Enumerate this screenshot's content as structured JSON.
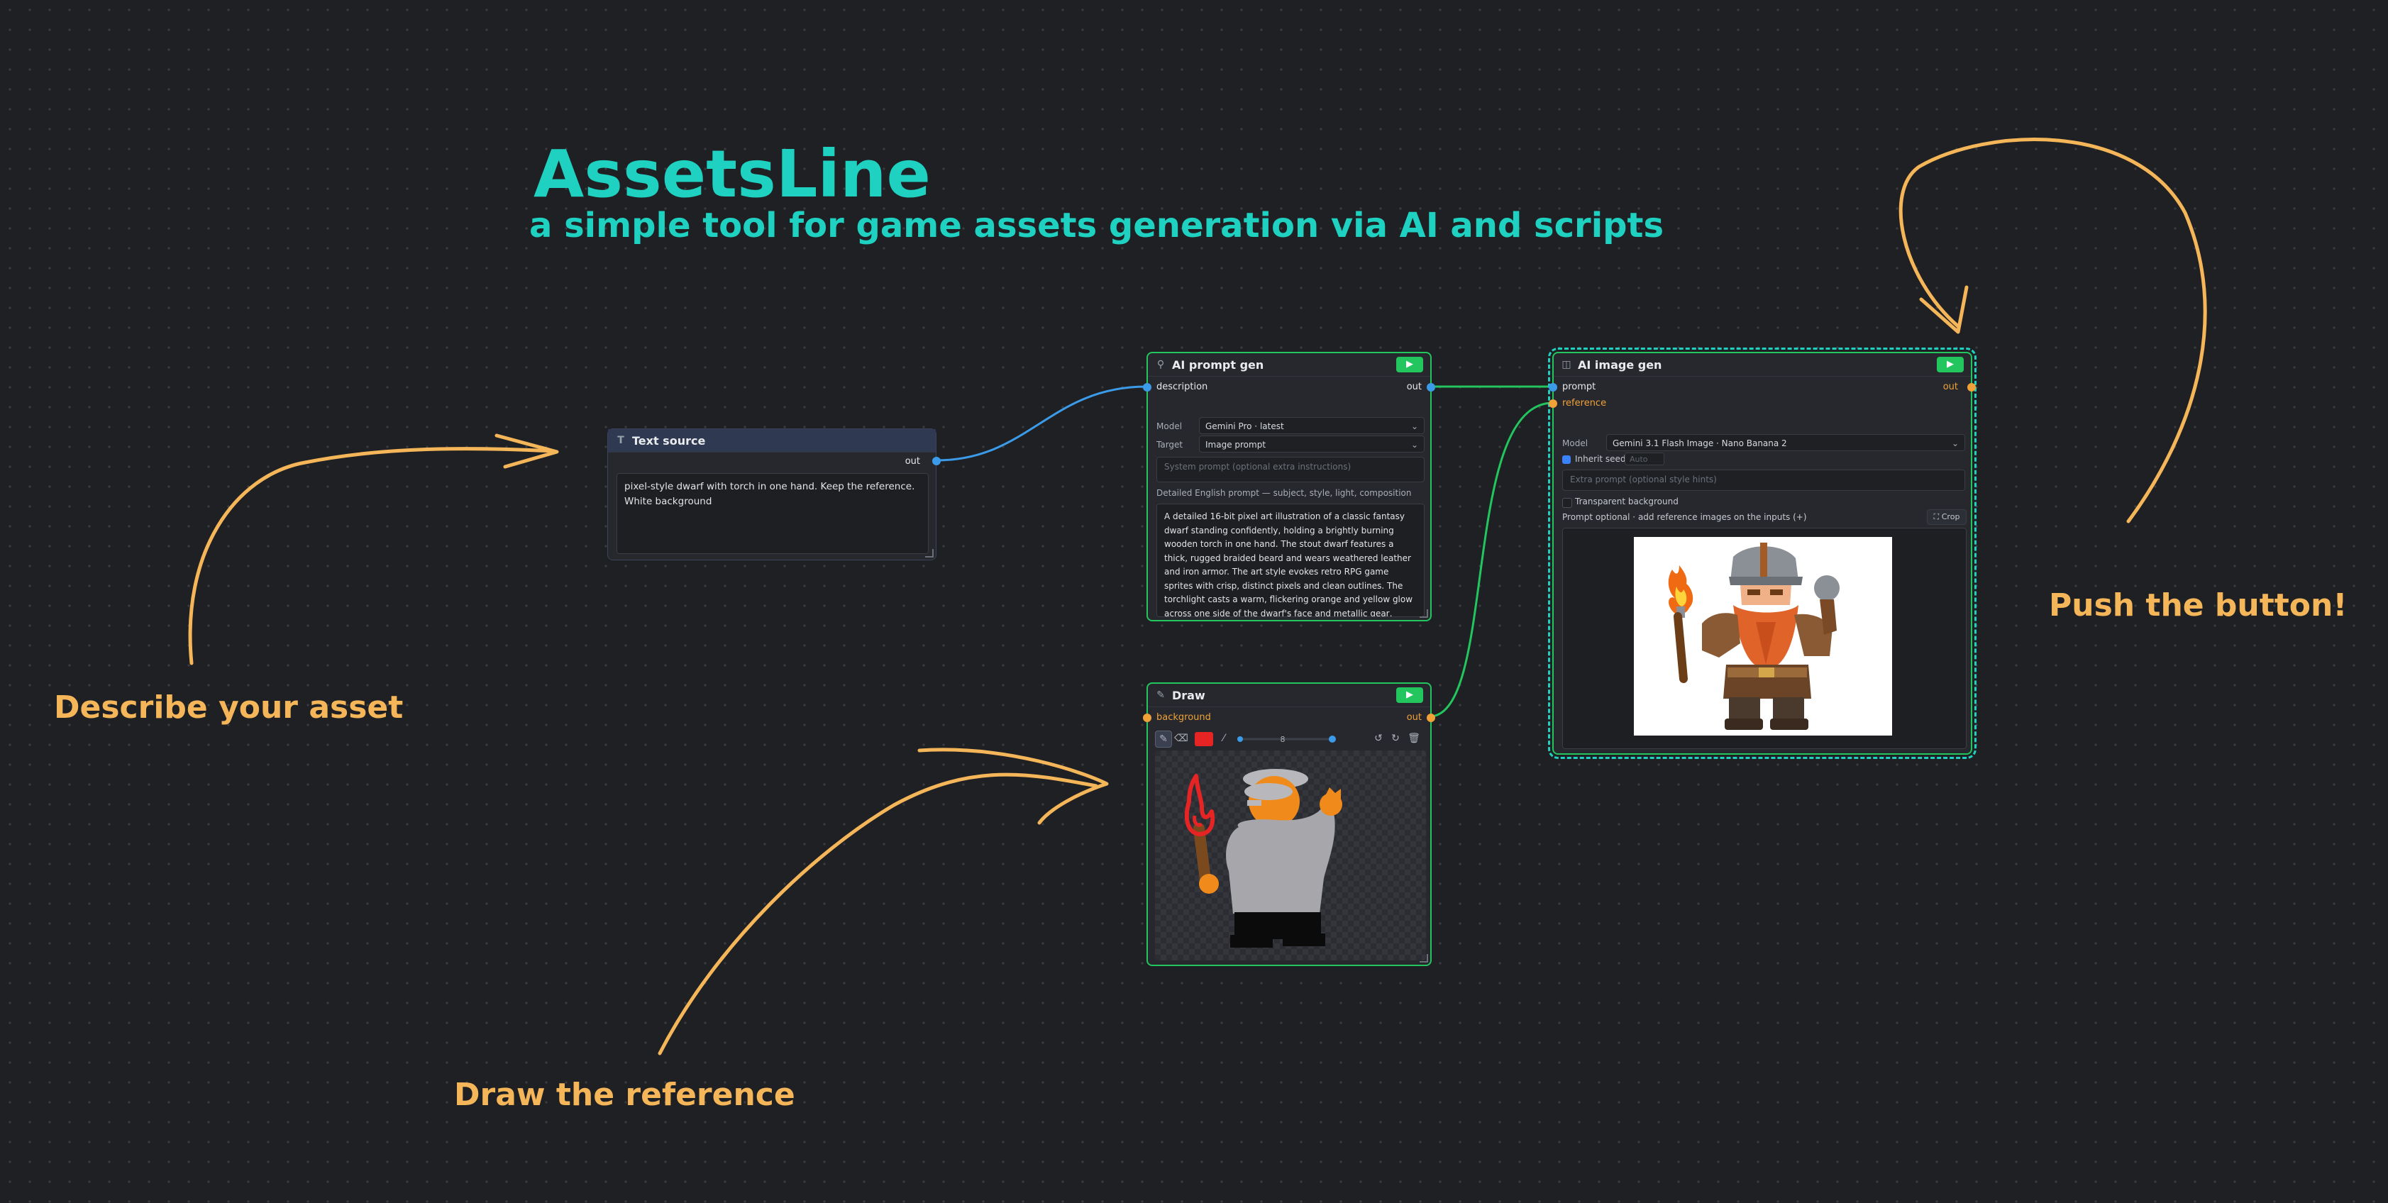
{
  "app": {
    "title": "AssetsLine",
    "subtitle": "a simple tool for game assets generation via AI and scripts"
  },
  "annotations": {
    "describe": "Describe your asset",
    "draw": "Draw the reference",
    "push": "Push the button!"
  },
  "colors": {
    "accent": "#1fd1c1",
    "annotation": "#f5b65a",
    "run_button": "#22c55e",
    "port_text": "#3b9be8",
    "port_image": "#f0a138",
    "edge_text": "#3b9be8",
    "edge_image": "#22c55e",
    "selected_outline": "#1fd1c1"
  },
  "nodes": {
    "text_source": {
      "title": "Text source",
      "icon": "text-icon",
      "out_label": "out",
      "text": "pixel-style dwarf with torch in one hand. Keep the reference. White background"
    },
    "ai_prompt_gen": {
      "title": "AI prompt gen",
      "icon": "wand-icon",
      "input_label": "description",
      "out_label": "out",
      "model_label": "Model",
      "model_value": "Gemini Pro · latest",
      "target_label": "Target",
      "target_value": "Image prompt",
      "system_prompt_placeholder": "System prompt (optional extra instructions)",
      "output_caption": "Detailed English prompt — subject, style, light, composition",
      "output_text": "A detailed 16-bit pixel art illustration of a classic fantasy dwarf standing confidently, holding a brightly burning wooden torch in one hand. The stout dwarf features a thick, rugged braided beard and wears weathered leather and iron armor. The art style evokes retro RPG game sprites with crisp, distinct pixels and clean outlines. The torchlight casts a warm, flickering orange and yellow glow across one side of the dwarf's face and metallic gear, creating dynamic lighting within the pixel medium. The character is perfectly centered, fully visible, and isolated against"
    },
    "draw": {
      "title": "Draw",
      "icon": "pencil-icon",
      "input_label": "background",
      "out_label": "out",
      "brush_color": "#e62424",
      "brush_size": 8
    },
    "ai_image_gen": {
      "title": "AI image gen",
      "icon": "image-icon",
      "prompt_label": "prompt",
      "reference_label": "reference",
      "out_label": "out",
      "model_label": "Model",
      "model_value": "Gemini 3.1 Flash Image · Nano Banana 2",
      "inherit_seed_label": "Inherit seed",
      "seed_placeholder": "Auto",
      "inherit_seed_checked": true,
      "extra_prompt_placeholder": "Extra prompt (optional style hints)",
      "transparent_label": "Transparent background",
      "transparent_checked": false,
      "hint": "Prompt optional · add reference images on the inputs (+)",
      "crop_label": "Crop"
    }
  }
}
